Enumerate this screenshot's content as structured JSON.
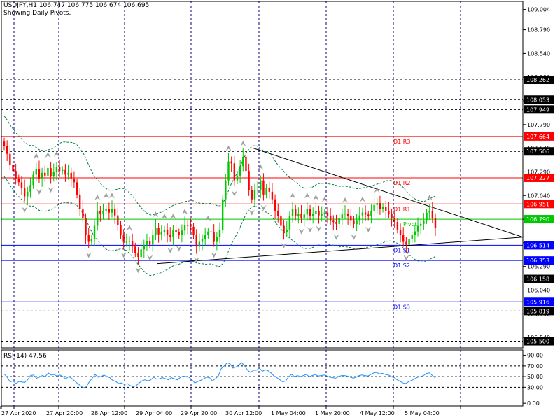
{
  "header": {
    "line1": "USDJPY,H1  106.747 106.775 106.674 106.695",
    "line2": "Showing Daily Pivots."
  },
  "rsi_label": "RSI(14) 47.56",
  "colors": {
    "up_candle": "#00c800",
    "down_candle": "#ff0000",
    "pivot_red": "#ff0000",
    "pivot_green": "#00c800",
    "support_blue": "#0000ff",
    "bands": "#008040",
    "rsi_line": "#1e90ff",
    "grid": "#000080",
    "fractal": "#a0a0a0",
    "trendline": "#000000"
  },
  "chart_data": [
    {
      "type": "candlestick",
      "symbol": "USDJPY",
      "timeframe": "H1",
      "ylim": [
        105.43,
        109.09
      ],
      "price_ticks": [
        109.004,
        108.79,
        108.54,
        108.29,
        108.04,
        107.79,
        107.54,
        107.29,
        107.04,
        106.79,
        106.54,
        106.29,
        106.04,
        105.79,
        105.54
      ],
      "price_tick_labels": [
        "109.004",
        "108.790",
        "108.540",
        "108.290",
        "108.040",
        "107.790",
        "107.540",
        "107.290",
        "107.040",
        "106.790",
        "106.540",
        "106.290",
        "106.040",
        "105.790",
        "105.540"
      ],
      "time_labels": [
        "27 Apr 2020",
        "27 Apr 20:00",
        "28 Apr 12:00",
        "29 Apr 04:00",
        "29 Apr 20:00",
        "30 Apr 12:00",
        "1 May 04:00",
        "1 May 20:00",
        "4 May 12:00",
        "5 May 04:00"
      ],
      "dotted_levels": [
        {
          "value": 108.262,
          "label": "108.262"
        },
        {
          "value": 108.053,
          "label": "108.053"
        },
        {
          "value": 107.949,
          "label": "107.949"
        },
        {
          "value": 107.506,
          "label": "107.506"
        },
        {
          "value": 106.158,
          "label": "106.158"
        },
        {
          "value": 105.819,
          "label": "105.819"
        },
        {
          "value": 105.5,
          "label": "105.500"
        }
      ],
      "pivots": [
        {
          "name": "D1 R3",
          "value": 107.664,
          "label": "107.664",
          "color": "red"
        },
        {
          "name": "D1 R2",
          "value": 107.227,
          "label": "107.227",
          "color": "red"
        },
        {
          "name": "D1 R1",
          "value": 106.951,
          "label": "106.951",
          "color": "red"
        },
        {
          "name": "Pivot",
          "value": 106.79,
          "label": "106.790",
          "color": "green"
        },
        {
          "name": "D1 S1",
          "value": 106.514,
          "label": "106.514",
          "color": "blue"
        },
        {
          "name": "D1 S2",
          "value": 106.353,
          "label": "106.353",
          "color": "blue"
        },
        {
          "name": "D1 S3",
          "value": 105.916,
          "label": "105.916",
          "color": "blue"
        }
      ],
      "closes": [
        107.56,
        107.48,
        107.36,
        107.3,
        107.22,
        107.18,
        107.12,
        107.03,
        107.08,
        107.15,
        107.26,
        107.32,
        107.22,
        107.28,
        107.25,
        107.33,
        107.24,
        107.29,
        107.34,
        107.3,
        107.31,
        107.26,
        107.28,
        107.22,
        107.18,
        107.05,
        106.9,
        106.8,
        106.62,
        106.55,
        106.58,
        106.72,
        106.88,
        106.85,
        106.88,
        106.9,
        106.86,
        106.9,
        106.83,
        106.73,
        106.62,
        106.55,
        106.55,
        106.56,
        106.5,
        106.43,
        106.39,
        106.47,
        106.52,
        106.56,
        106.52,
        106.62,
        106.7,
        106.63,
        106.65,
        106.68,
        106.62,
        106.6,
        106.68,
        106.65,
        106.62,
        106.67,
        106.73,
        106.72,
        106.71,
        106.62,
        106.5,
        106.55,
        106.58,
        106.62,
        106.66,
        106.65,
        106.55,
        106.6,
        106.68,
        107.0,
        107.2,
        107.4,
        107.38,
        107.2,
        107.25,
        107.35,
        107.45,
        107.3,
        107.1,
        107.0,
        107.1,
        107.1,
        107.2,
        107.05,
        107.12,
        107.08,
        107.0,
        106.88,
        106.82,
        106.72,
        106.65,
        106.68,
        106.82,
        106.9,
        106.82,
        106.85,
        106.8,
        106.84,
        106.9,
        106.82,
        106.85,
        106.88,
        106.83,
        106.85,
        106.86,
        106.82,
        106.78,
        106.76,
        106.74,
        106.8,
        106.84,
        106.85,
        106.82,
        106.78,
        106.74,
        106.78,
        106.83,
        106.86,
        106.84,
        106.82,
        106.88,
        106.94,
        106.96,
        106.9,
        106.92,
        106.88,
        106.85,
        106.8,
        106.76,
        106.68,
        106.62,
        106.55,
        106.52,
        106.58,
        106.62,
        106.66,
        106.72,
        106.74,
        106.78,
        106.86,
        106.88,
        106.8,
        106.7
      ],
      "trendlines": [
        {
          "from": [
            106.89,
            107.54
          ],
          "to": [
            106.78,
            106.6
          ]
        },
        {
          "from": [
            106.22,
            106.32
          ],
          "to": [
            106.78,
            106.6
          ]
        }
      ]
    },
    {
      "type": "line",
      "name": "RSI(14)",
      "ylim": [
        -5,
        100
      ],
      "y_ticks": [
        0,
        30,
        50,
        70,
        90
      ],
      "y_tick_labels": [
        "0.00",
        "30.00",
        "50.00",
        "70.00",
        "90.00"
      ],
      "levels": [
        30,
        50,
        70
      ],
      "values": [
        55,
        49,
        40,
        42,
        37,
        41,
        40,
        39,
        44,
        52,
        53,
        47,
        49,
        52,
        50,
        57,
        53,
        54,
        51,
        53,
        50,
        46,
        50,
        47,
        42,
        37,
        33,
        29,
        31,
        40,
        47,
        54,
        49,
        50,
        53,
        50,
        48,
        43,
        41,
        37,
        38,
        35,
        37,
        33,
        31,
        33,
        38,
        42,
        44,
        42,
        44,
        49,
        45,
        46,
        48,
        46,
        44,
        48,
        46,
        44,
        48,
        51,
        50,
        49,
        44,
        38,
        41,
        43,
        46,
        49,
        48,
        42,
        46,
        51,
        65,
        70,
        76,
        74,
        66,
        68,
        72,
        76,
        70,
        62,
        58,
        62,
        62,
        66,
        60,
        63,
        61,
        57,
        51,
        48,
        44,
        40,
        42,
        50,
        54,
        50,
        52,
        50,
        52,
        54,
        50,
        52,
        54,
        51,
        52,
        53,
        51,
        49,
        48,
        47,
        50,
        52,
        52,
        51,
        49,
        47,
        49,
        52,
        53,
        52,
        51,
        54,
        57,
        58,
        55,
        56,
        54,
        53,
        50,
        48,
        44,
        41,
        38,
        37,
        41,
        43,
        46,
        49,
        50,
        52,
        56,
        57,
        52,
        47.56
      ]
    }
  ]
}
